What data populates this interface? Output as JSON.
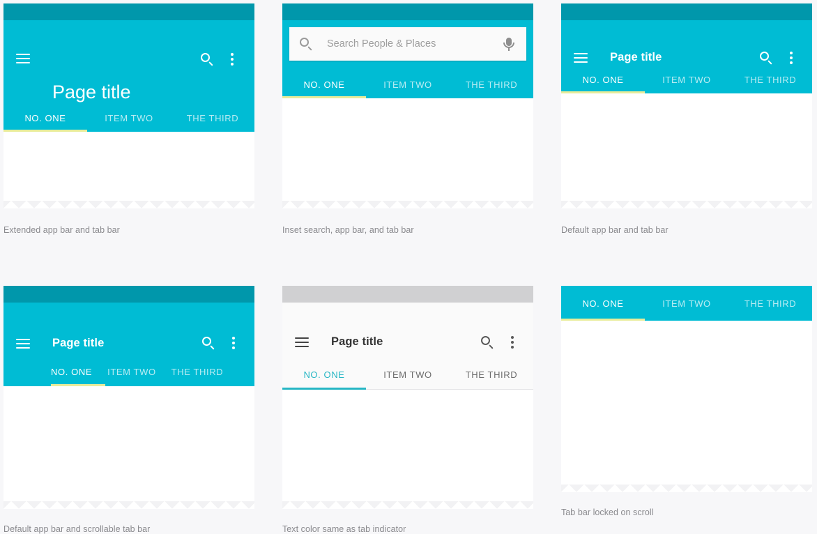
{
  "page": {
    "background": "#f7f7f9",
    "accent_teal": "#00bcd4",
    "status_teal": "#0097ab",
    "indicator_yellow": "#e8ec9a",
    "indicator_teal": "#26b6c4",
    "caption_color": "#8a8a8e"
  },
  "tabs": {
    "one": "NO. ONE",
    "two": "ITEM TWO",
    "three": "THE THIRD"
  },
  "icons": {
    "menu": "hamburger-menu-icon",
    "search": "search-icon",
    "more": "overflow-menu-icon",
    "mic": "microphone-icon"
  },
  "panels": [
    {
      "id": "extended-app-bar",
      "title": "Page title",
      "caption": "Extended app bar and tab bar",
      "active_tab": "NO. ONE"
    },
    {
      "id": "inset-search",
      "search_placeholder": "Search People  & Places",
      "caption": "Inset search, app bar, and tab bar",
      "active_tab": "NO. ONE"
    },
    {
      "id": "default-app-bar",
      "title": "Page title",
      "caption": "Default app bar and tab bar",
      "active_tab": "NO. ONE"
    },
    {
      "id": "scrollable-tab-bar",
      "title": "Page title",
      "caption": "Default app bar and scrollable tab bar",
      "active_tab": "NO. ONE"
    },
    {
      "id": "text-color-matches-indicator",
      "title": "Page title",
      "caption": "Text color same as tab indicator",
      "active_tab": "NO. ONE"
    },
    {
      "id": "tab-bar-locked",
      "caption": "Tab bar locked on scroll",
      "active_tab": "NO. ONE"
    }
  ]
}
